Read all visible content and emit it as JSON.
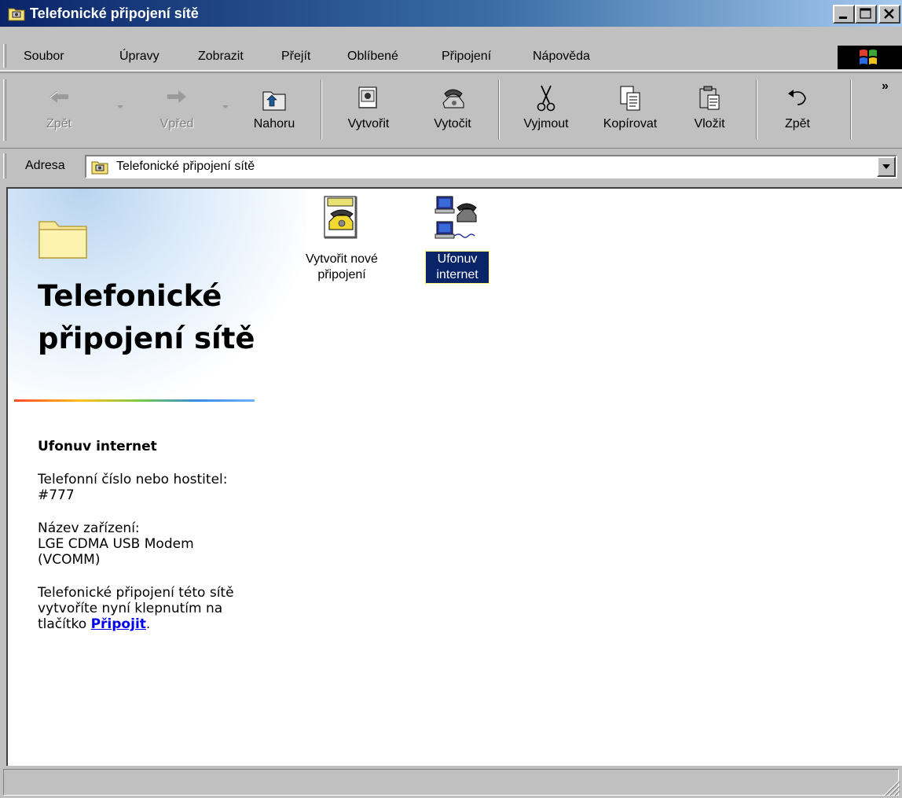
{
  "window": {
    "title": "Telefonické připojení sítě"
  },
  "menu": {
    "items": [
      {
        "label": "Soubor"
      },
      {
        "label": "Úpravy"
      },
      {
        "label": "Zobrazit"
      },
      {
        "label": "Přejít"
      },
      {
        "label": "Oblíbené"
      },
      {
        "label": "Připojení"
      },
      {
        "label": "Nápověda"
      }
    ]
  },
  "toolbar": {
    "back": "Zpět",
    "forward": "Vpřed",
    "up": "Nahoru",
    "create": "Vytvořit",
    "dial": "Vytočit",
    "cut": "Vyjmout",
    "copy": "Kopírovat",
    "paste": "Vložit",
    "undo": "Zpět",
    "more": "»"
  },
  "address": {
    "label": "Adresa",
    "value": "Telefonické připojení sítě"
  },
  "panel": {
    "title": "Telefonické připojení sítě",
    "selected_name": "Ufonuv internet",
    "phone_label": "Telefonní číslo nebo hostitel:",
    "phone_value": "#777",
    "device_label": "Název zařízení:",
    "device_value": "LGE CDMA USB Modem (VCOMM)",
    "hint_text": "Telefonické připojení této sítě vytvoříte nyní klepnutím na tlačítko",
    "hint_link": "Připojit",
    "hint_end": "."
  },
  "icons": [
    {
      "label": "Vytvořit nové připojení",
      "icon": "make-new-connection-icon",
      "selected": false
    },
    {
      "label": "Ufonuv internet",
      "icon": "dialup-connection-icon",
      "selected": true
    }
  ],
  "colors": {
    "titlebar_start": "#0a246a",
    "titlebar_end": "#a6caf0",
    "selection": "#0a246a",
    "link": "#0000ee",
    "chrome": "#c0c0c0"
  }
}
